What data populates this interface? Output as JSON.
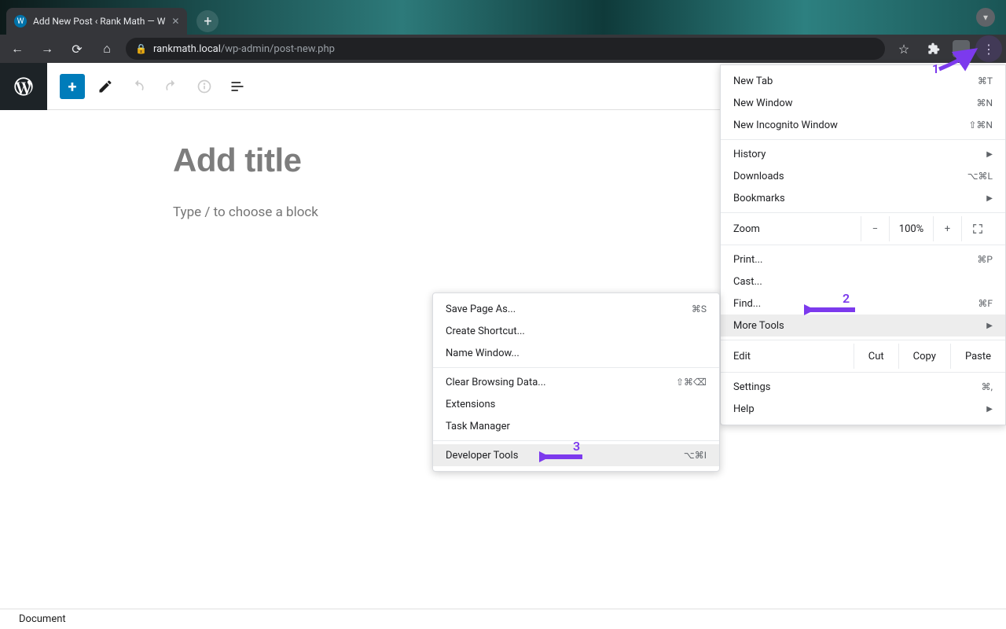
{
  "tab": {
    "title": "Add New Post ‹ Rank Math — W",
    "favicon_letter": "W"
  },
  "url": {
    "host": "rankmath.local",
    "path": "/wp-admin/post-new.php"
  },
  "editor": {
    "title_placeholder": "Add title",
    "body_placeholder": "Type / to choose a block"
  },
  "footer": {
    "label": "Document"
  },
  "menu": {
    "new_tab": "New Tab",
    "new_tab_sc": "⌘T",
    "new_window": "New Window",
    "new_window_sc": "⌘N",
    "new_incognito": "New Incognito Window",
    "new_incognito_sc": "⇧⌘N",
    "history": "History",
    "downloads": "Downloads",
    "downloads_sc": "⌥⌘L",
    "bookmarks": "Bookmarks",
    "zoom": "Zoom",
    "zoom_minus": "−",
    "zoom_val": "100%",
    "zoom_plus": "+",
    "print": "Print...",
    "print_sc": "⌘P",
    "cast": "Cast...",
    "find": "Find...",
    "find_sc": "⌘F",
    "more_tools": "More Tools",
    "edit": "Edit",
    "cut": "Cut",
    "copy": "Copy",
    "paste": "Paste",
    "settings": "Settings",
    "settings_sc": "⌘,",
    "help": "Help"
  },
  "submenu": {
    "save_as": "Save Page As...",
    "save_as_sc": "⌘S",
    "create_shortcut": "Create Shortcut...",
    "name_window": "Name Window...",
    "clear_data": "Clear Browsing Data...",
    "clear_data_sc": "⇧⌘⌫",
    "extensions": "Extensions",
    "task_manager": "Task Manager",
    "dev_tools": "Developer Tools",
    "dev_tools_sc": "⌥⌘I"
  },
  "annotations": {
    "n1": "1",
    "n2": "2",
    "n3": "3"
  }
}
